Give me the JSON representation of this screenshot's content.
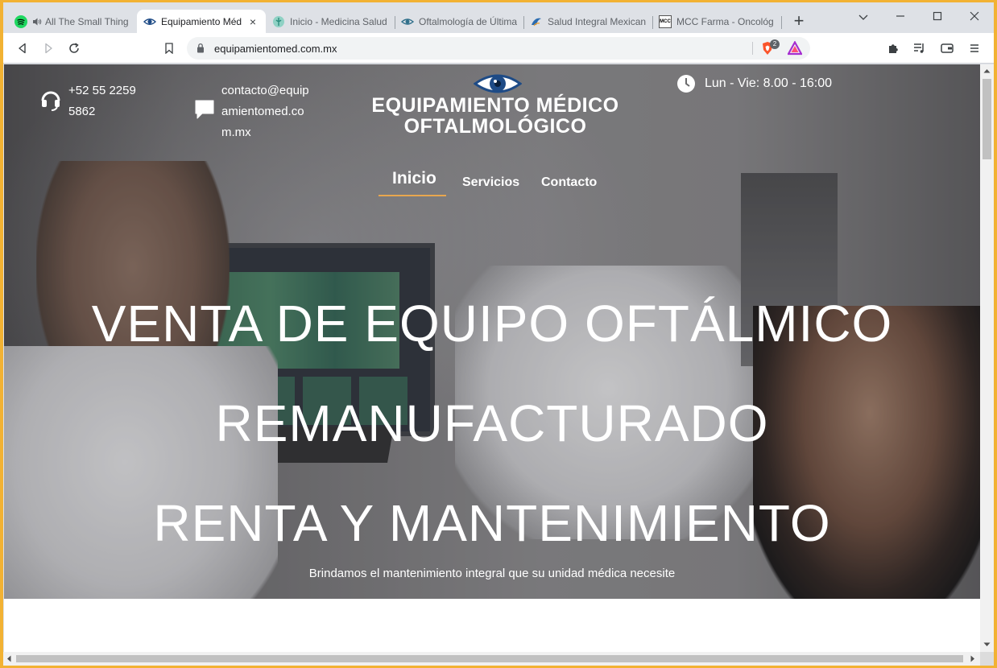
{
  "browser": {
    "tabs": [
      {
        "title": "All The Small Thing",
        "icon": "spotify-icon",
        "audio": true
      },
      {
        "title": "Equipamiento Méd",
        "icon": "eye-icon",
        "active": true
      },
      {
        "title": "Inicio - Medicina Salud",
        "icon": "medical-logo-icon"
      },
      {
        "title": "Oftalmología de Última",
        "icon": "eye-icon"
      },
      {
        "title": "Salud Integral Mexican",
        "icon": "bird-logo-icon"
      },
      {
        "title": "MCC Farma - Oncológ",
        "icon": "mcc-logo-icon",
        "favicon_text": "MCC"
      }
    ],
    "close_symbol": "×",
    "new_tab_symbol": "+",
    "url": "equipamientomed.com.mx",
    "brave_badge": "2"
  },
  "site": {
    "phone": "+52 55 2259 5862",
    "email": "contacto@equipamientomed.com.mx",
    "logo_line1": "EQUIPAMIENTO MÉDICO",
    "logo_line2": "OFTALMOLÓGICO",
    "hours": "Lun - Vie: 8.00 - 16:00",
    "nav": [
      "Inicio",
      "Servicios",
      "Contacto"
    ],
    "headline": [
      "VENTA DE EQUIPO OFTÁLMICO",
      "REMANUFACTURADO",
      "RENTA Y MANTENIMIENTO"
    ],
    "subtitle": "Brindamos el mantenimiento integral que su unidad médica necesite"
  },
  "colors": {
    "nav_accent": "#e8a74f",
    "logo_blue": "#1e4b86"
  }
}
